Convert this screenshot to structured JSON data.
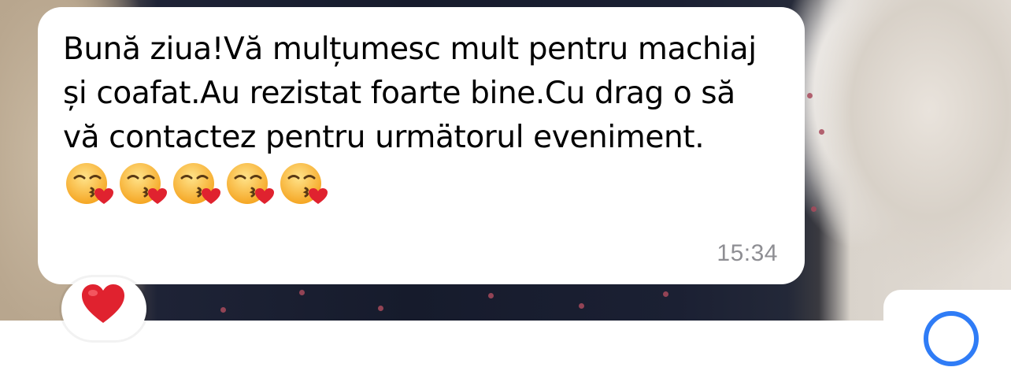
{
  "message": {
    "text": "Bună ziua!Vă mulțumesc mult pentru machiaj și coafat.Au rezistat foarte bine.Cu drag o să vă contactez pentru urmätorul eveniment.",
    "emojis": [
      "kissing-heart",
      "kissing-heart",
      "kissing-heart",
      "kissing-heart",
      "kissing-heart"
    ],
    "time": "15:34"
  },
  "reaction": {
    "icon": "heart-icon",
    "color": "#e0222f"
  },
  "next_message": {
    "icon": "circle-icon",
    "color": "#2f7cf6"
  },
  "colors": {
    "bubble": "#ffffff",
    "timestamp": "#8e8e93"
  }
}
